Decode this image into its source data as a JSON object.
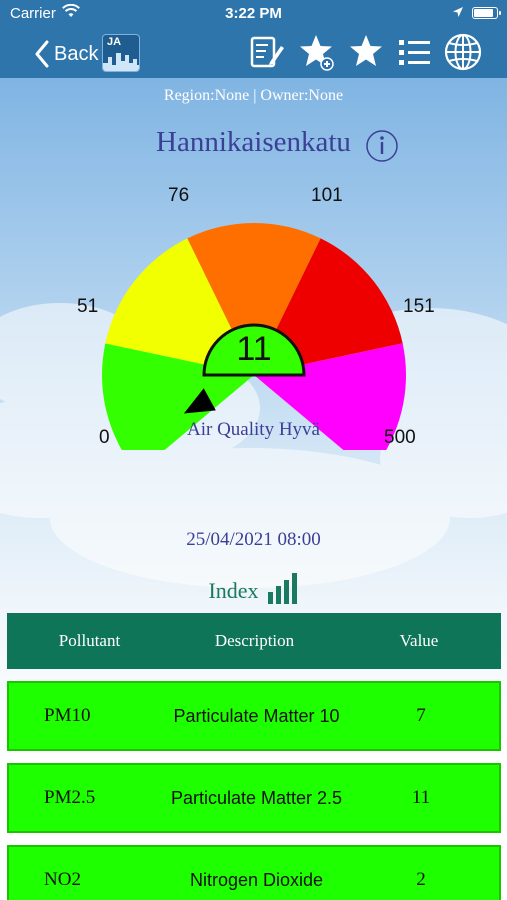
{
  "status_bar": {
    "carrier": "Carrier",
    "time": "3:22 PM",
    "battery_level": 0.85
  },
  "nav": {
    "back_label": "Back",
    "logo_text": "JA",
    "icons": [
      "notes-edit-icon",
      "star-add-icon",
      "star-icon",
      "list-icon",
      "globe-icon"
    ]
  },
  "header": {
    "region_owner": "Region:None | Owner:None",
    "station_name": "Hannikaisenkatu"
  },
  "gauge": {
    "value": "11",
    "value_number": 11,
    "quality_label": "Air Quality Hyvä",
    "ticks": [
      "0",
      "51",
      "76",
      "101",
      "151",
      "500"
    ],
    "bands": [
      {
        "from": 0,
        "to": 51,
        "color": "#33ff00"
      },
      {
        "from": 51,
        "to": 76,
        "color": "#f2ff00"
      },
      {
        "from": 76,
        "to": 101,
        "color": "#ff6f00"
      },
      {
        "from": 101,
        "to": 151,
        "color": "#ee0000"
      },
      {
        "from": 151,
        "to": 500,
        "color": "#ff00ff"
      }
    ],
    "center_color": "#33ff00"
  },
  "timestamp": "25/04/2021 08:00",
  "index_label": "Index",
  "table": {
    "headers": [
      "Pollutant",
      "Description",
      "Value"
    ],
    "rows": [
      {
        "pollutant": "PM10",
        "description": "Particulate Matter 10",
        "value": "7"
      },
      {
        "pollutant": "PM2.5",
        "description": "Particulate Matter 2.5",
        "value": "11"
      },
      {
        "pollutant": "NO2",
        "description": "Nitrogen Dioxide",
        "value": "2"
      }
    ],
    "row_color": "#1eff00",
    "header_color": "#0f7559"
  }
}
